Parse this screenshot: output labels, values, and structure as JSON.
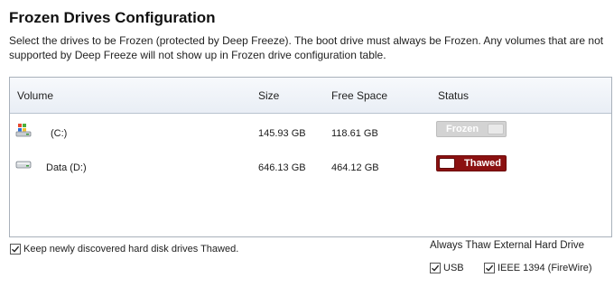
{
  "header": {
    "title": "Frozen Drives Configuration",
    "description": "Select the drives to be Frozen (protected by Deep Freeze). The boot drive must always be Frozen. Any volumes that are not supported by Deep Freeze will not show up in Frozen drive configuration table."
  },
  "table": {
    "columns": [
      "Volume",
      "Size",
      "Free Space",
      "Status"
    ],
    "rows": [
      {
        "volume": "(C:)",
        "size": "145.93 GB",
        "free": "118.61 GB",
        "status": "Frozen",
        "icon": "windows-drive-icon"
      },
      {
        "volume": "Data (D:)",
        "size": "646.13 GB",
        "free": "464.12 GB",
        "status": "Thawed",
        "icon": "hard-drive-icon"
      }
    ]
  },
  "options": {
    "keep_thawed_label": "Keep newly discovered hard disk drives Thawed.",
    "keep_thawed_checked": true,
    "external_title": "Always Thaw External Hard Drive",
    "usb_label": "USB",
    "usb_checked": true,
    "firewire_label": "IEEE 1394 (FireWire)",
    "firewire_checked": true
  },
  "colors": {
    "thawed": "#8b1111",
    "frozen": "#d3d3d3",
    "header_bg": "#eef2f7"
  }
}
